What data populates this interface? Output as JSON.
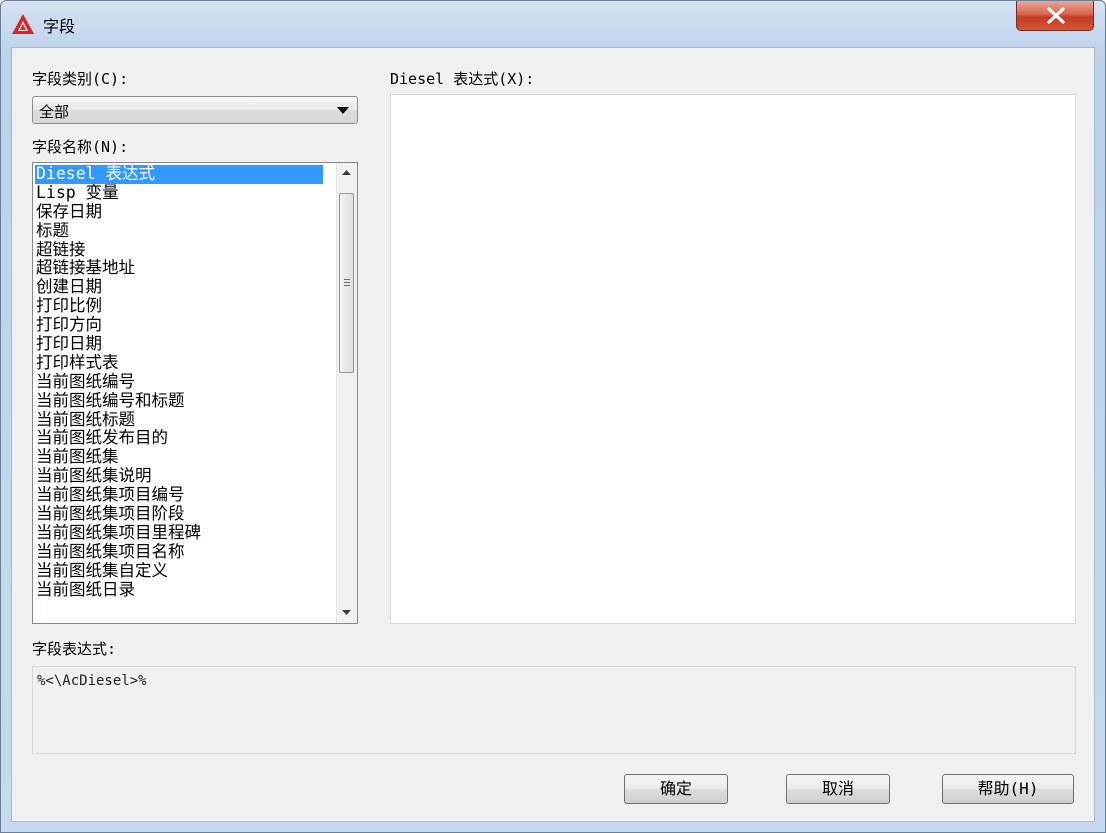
{
  "window": {
    "title": "字段",
    "close_label": "X"
  },
  "field_category": {
    "label": "字段类别(C):",
    "selected": "全部"
  },
  "field_names": {
    "label": "字段名称(N):",
    "items": [
      "Diesel 表达式",
      "Lisp 变量",
      "保存日期",
      "标题",
      "超链接",
      "超链接基地址",
      "创建日期",
      "打印比例",
      "打印方向",
      "打印日期",
      "打印样式表",
      "当前图纸编号",
      "当前图纸编号和标题",
      "当前图纸标题",
      "当前图纸发布目的",
      "当前图纸集",
      "当前图纸集说明",
      "当前图纸集项目编号",
      "当前图纸集项目阶段",
      "当前图纸集项目里程碑",
      "当前图纸集项目名称",
      "当前图纸集自定义",
      "当前图纸日录"
    ],
    "selected_index": 0
  },
  "diesel_expression": {
    "label": "Diesel 表达式(X):",
    "value": ""
  },
  "field_expression": {
    "label": "字段表达式:",
    "value": "%<\\AcDiesel>%"
  },
  "buttons": {
    "ok": "确定",
    "cancel": "取消",
    "help": "帮助(H)"
  },
  "colors": {
    "selection": "#3399ff",
    "close_button": "#c23c22",
    "app_icon": "#d1262b"
  }
}
